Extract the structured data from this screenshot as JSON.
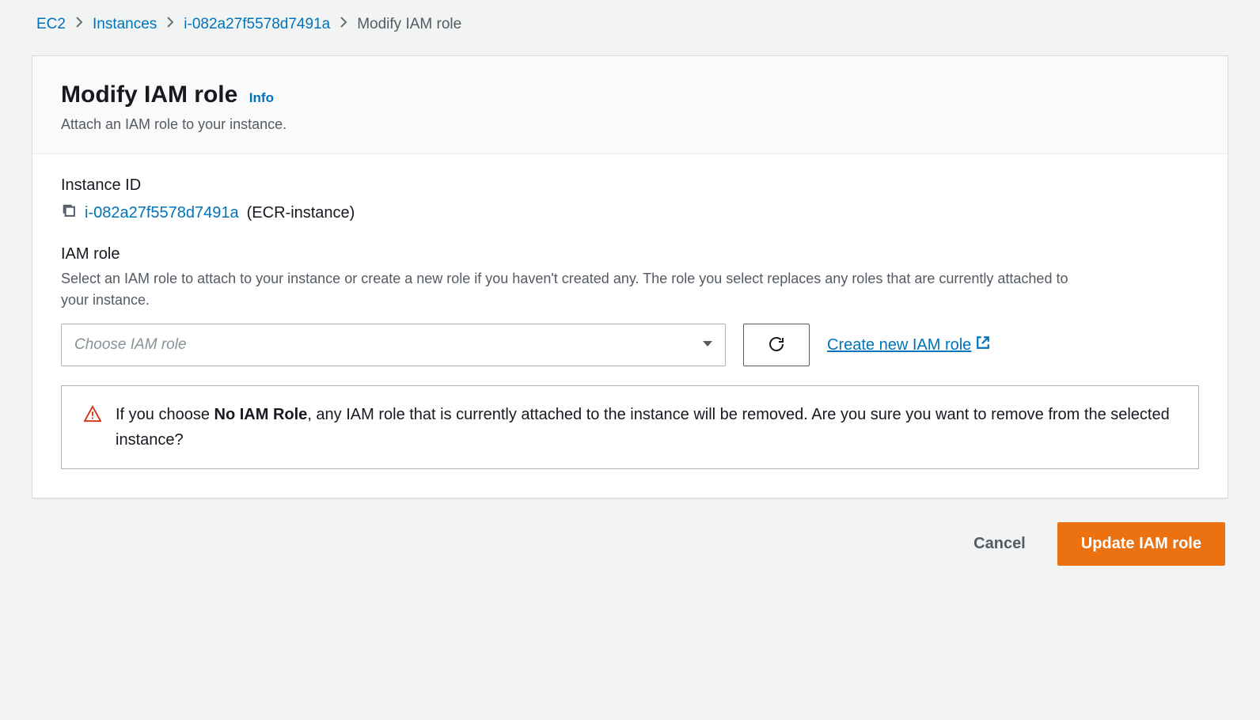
{
  "breadcrumb": {
    "items": [
      {
        "label": "EC2"
      },
      {
        "label": "Instances"
      },
      {
        "label": "i-082a27f5578d7491a"
      }
    ],
    "current": "Modify IAM role"
  },
  "header": {
    "title": "Modify IAM role",
    "info": "Info",
    "subtitle": "Attach an IAM role to your instance."
  },
  "instance": {
    "label": "Instance ID",
    "id": "i-082a27f5578d7491a",
    "name_suffix": " (ECR-instance)"
  },
  "iam": {
    "label": "IAM role",
    "description": "Select an IAM role to attach to your instance or create a new role if you haven't created any. The role you select replaces any roles that are currently attached to your instance.",
    "placeholder": "Choose IAM role",
    "create_link": "Create new IAM role"
  },
  "alert": {
    "text_before": "If you choose ",
    "bold": "No IAM Role",
    "text_after": ", any IAM role that is currently attached to the instance will be removed. Are you sure you want to remove from the selected instance?"
  },
  "actions": {
    "cancel": "Cancel",
    "update": "Update IAM role"
  }
}
